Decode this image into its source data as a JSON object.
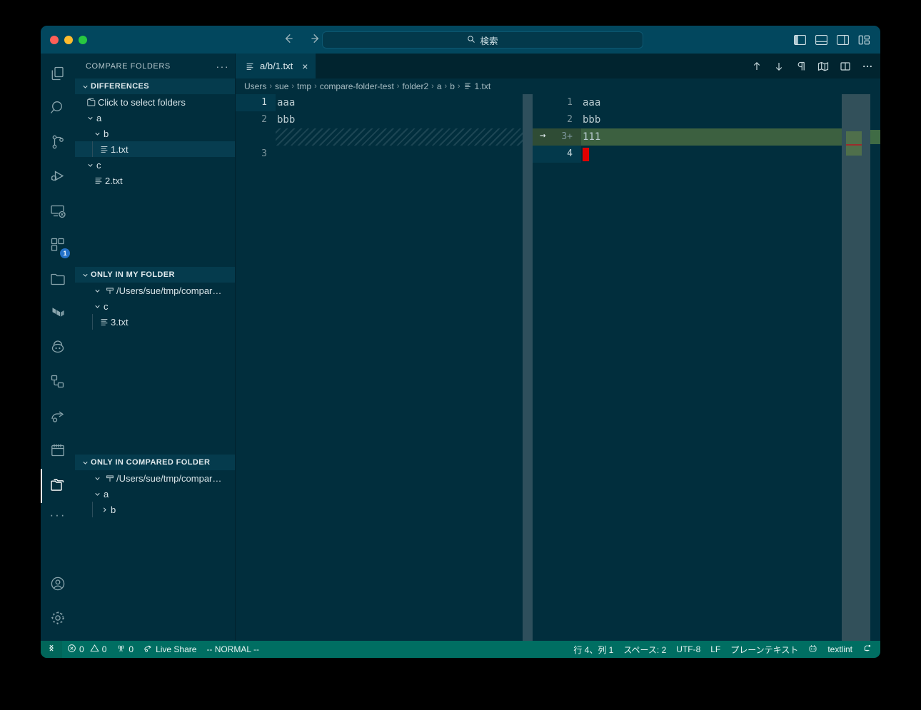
{
  "titlebar": {
    "traffic_lights": [
      "close",
      "minimize",
      "maximize"
    ],
    "back_icon": "arrow-left-icon",
    "forward_icon": "arrow-right-icon",
    "search_placeholder": "検索",
    "search_icon": "search-icon",
    "layout_buttons": [
      {
        "name": "toggle-primary-sidebar",
        "icon": "layout-sidebar-left-icon"
      },
      {
        "name": "toggle-panel",
        "icon": "layout-panel-icon"
      },
      {
        "name": "toggle-secondary-sidebar",
        "icon": "layout-sidebar-right-icon"
      },
      {
        "name": "customize-layout",
        "icon": "layout-customize-icon"
      }
    ]
  },
  "activitybar": {
    "items": [
      {
        "name": "explorer",
        "icon": "files-icon",
        "active": false,
        "badge": ""
      },
      {
        "name": "search",
        "icon": "search-icon",
        "active": false,
        "badge": ""
      },
      {
        "name": "source-control",
        "icon": "source-control-icon",
        "active": false,
        "badge": ""
      },
      {
        "name": "run-and-debug",
        "icon": "debug-icon",
        "active": false,
        "badge": ""
      },
      {
        "name": "remote-explorer",
        "icon": "remote-icon",
        "active": false,
        "badge": ""
      },
      {
        "name": "extensions",
        "icon": "extensions-icon",
        "active": false,
        "badge": "1"
      },
      {
        "name": "project-manager",
        "icon": "folder-icon",
        "active": false,
        "badge": ""
      },
      {
        "name": "terraform",
        "icon": "terraform-icon",
        "active": false,
        "badge": ""
      },
      {
        "name": "docker",
        "icon": "docker-icon",
        "active": false,
        "badge": ""
      },
      {
        "name": "dependencies",
        "icon": "nodes-icon",
        "active": false,
        "badge": ""
      },
      {
        "name": "share",
        "icon": "share-icon",
        "active": false,
        "badge": ""
      },
      {
        "name": "calendar",
        "icon": "calendar-icon",
        "active": false,
        "badge": ""
      },
      {
        "name": "compare-folders",
        "icon": "compare-folders-icon",
        "active": true,
        "badge": ""
      },
      {
        "name": "more-views",
        "icon": "ellipsis-icon",
        "active": false,
        "badge": ""
      }
    ],
    "bottom": [
      {
        "name": "accounts",
        "icon": "account-icon"
      },
      {
        "name": "manage-settings",
        "icon": "gear-icon"
      }
    ]
  },
  "sidebar": {
    "title": "COMPARE FOLDERS",
    "more_actions": "···",
    "sections": [
      {
        "name": "differences",
        "label": "DIFFERENCES",
        "expanded": true,
        "rows": [
          {
            "label": "Click to select folders",
            "icon": "select-folders-icon",
            "indent": 0,
            "twisty": "none",
            "selected": false,
            "guide": false
          },
          {
            "label": "a",
            "icon": "none",
            "indent": 0,
            "twisty": "down",
            "selected": false,
            "guide": false
          },
          {
            "label": "b",
            "icon": "none",
            "indent": 1,
            "twisty": "down",
            "selected": false,
            "guide": false
          },
          {
            "label": "1.txt",
            "icon": "text-file-icon",
            "indent": 2,
            "twisty": "none",
            "selected": true,
            "guide": true
          },
          {
            "label": "c",
            "icon": "none",
            "indent": 0,
            "twisty": "down",
            "selected": false,
            "guide": false
          },
          {
            "label": "2.txt",
            "icon": "text-file-icon",
            "indent": 1,
            "twisty": "none",
            "selected": false,
            "guide": false
          }
        ]
      },
      {
        "name": "only-in-my-folder",
        "label": "ONLY IN MY FOLDER",
        "expanded": true,
        "rows": [
          {
            "label": "/Users/sue/tmp/compar…",
            "icon": "folder-root-icon",
            "indent": 0,
            "twisty": "down",
            "selected": false,
            "guide": false
          },
          {
            "label": "c",
            "icon": "none",
            "indent": 1,
            "twisty": "down",
            "selected": false,
            "guide": false
          },
          {
            "label": "3.txt",
            "icon": "text-file-icon",
            "indent": 2,
            "twisty": "none",
            "selected": false,
            "guide": true
          }
        ]
      },
      {
        "name": "only-in-compared-folder",
        "label": "ONLY IN COMPARED FOLDER",
        "expanded": true,
        "rows": [
          {
            "label": "/Users/sue/tmp/compar…",
            "icon": "folder-root-icon",
            "indent": 0,
            "twisty": "down",
            "selected": false,
            "guide": false
          },
          {
            "label": "a",
            "icon": "none",
            "indent": 1,
            "twisty": "down",
            "selected": false,
            "guide": false
          },
          {
            "label": "b",
            "icon": "none",
            "indent": 2,
            "twisty": "right",
            "selected": false,
            "guide": true
          }
        ]
      }
    ]
  },
  "editor": {
    "tab": {
      "label": "a/b/1.txt",
      "icon": "text-file-icon",
      "close": "×"
    },
    "actions": [
      {
        "name": "previous-change",
        "icon": "arrow-up-icon"
      },
      {
        "name": "next-change",
        "icon": "arrow-down-icon"
      },
      {
        "name": "toggle-whitespace",
        "icon": "pilcrow-icon"
      },
      {
        "name": "toggle-inline-view",
        "icon": "map-icon"
      },
      {
        "name": "split-editor",
        "icon": "split-editor-icon"
      },
      {
        "name": "more-actions",
        "icon": "ellipsis-icon"
      }
    ],
    "breadcrumbs": [
      "Users",
      "sue",
      "tmp",
      "compare-folder-test",
      "folder2",
      "a",
      "b"
    ],
    "breadcrumb_leaf": "1.txt",
    "breadcrumb_leaf_icon": "text-file-icon",
    "left_pane": {
      "lines": [
        {
          "num": "1",
          "text": "aaa",
          "kind": "normal",
          "current": true
        },
        {
          "num": "2",
          "text": "bbb",
          "kind": "normal",
          "current": false
        },
        {
          "num": "",
          "text": "",
          "kind": "hatch",
          "current": false
        },
        {
          "num": "3",
          "text": "",
          "kind": "normal",
          "current": false
        }
      ]
    },
    "right_pane": {
      "lines": [
        {
          "num": "1",
          "text": "aaa",
          "kind": "normal",
          "marker": "",
          "current": false
        },
        {
          "num": "2",
          "text": "bbb",
          "kind": "normal",
          "marker": "",
          "current": false
        },
        {
          "num": "3+",
          "text": "111",
          "kind": "inserted",
          "marker": "→",
          "current": false
        },
        {
          "num": "4",
          "text": "",
          "kind": "cursor",
          "marker": "",
          "current": true
        }
      ]
    }
  },
  "statusbar": {
    "remote_icon": "remote-indicator-icon",
    "left": [
      {
        "name": "problems",
        "icon": "error-icon",
        "text": "0",
        "icon2": "warning-icon",
        "text2": "0"
      },
      {
        "name": "ports",
        "icon": "radio-tower-icon",
        "text": "0"
      },
      {
        "name": "live-share",
        "icon": "live-share-icon",
        "text": "Live Share"
      },
      {
        "name": "vim-mode",
        "icon": "",
        "text": "-- NORMAL --"
      }
    ],
    "right": [
      {
        "name": "cursor-position",
        "text": "行 4、列 1"
      },
      {
        "name": "indentation",
        "text": "スペース: 2"
      },
      {
        "name": "encoding",
        "text": "UTF-8"
      },
      {
        "name": "eol",
        "text": "LF"
      },
      {
        "name": "language-mode",
        "text": "プレーンテキスト"
      },
      {
        "name": "textlint-icon-item",
        "text": "",
        "icon": "robot-icon"
      },
      {
        "name": "textlint-status",
        "text": "textlint"
      },
      {
        "name": "notifications",
        "text": "",
        "icon": "bell-dot-icon"
      }
    ]
  },
  "colors": {
    "window_bg": "#012e3d",
    "titlebar_bg": "#02475e",
    "statusbar_bg": "#006e62",
    "insert_green": "#3c6040",
    "cursor_red": "#e20000",
    "badge_blue": "#2472c8"
  }
}
